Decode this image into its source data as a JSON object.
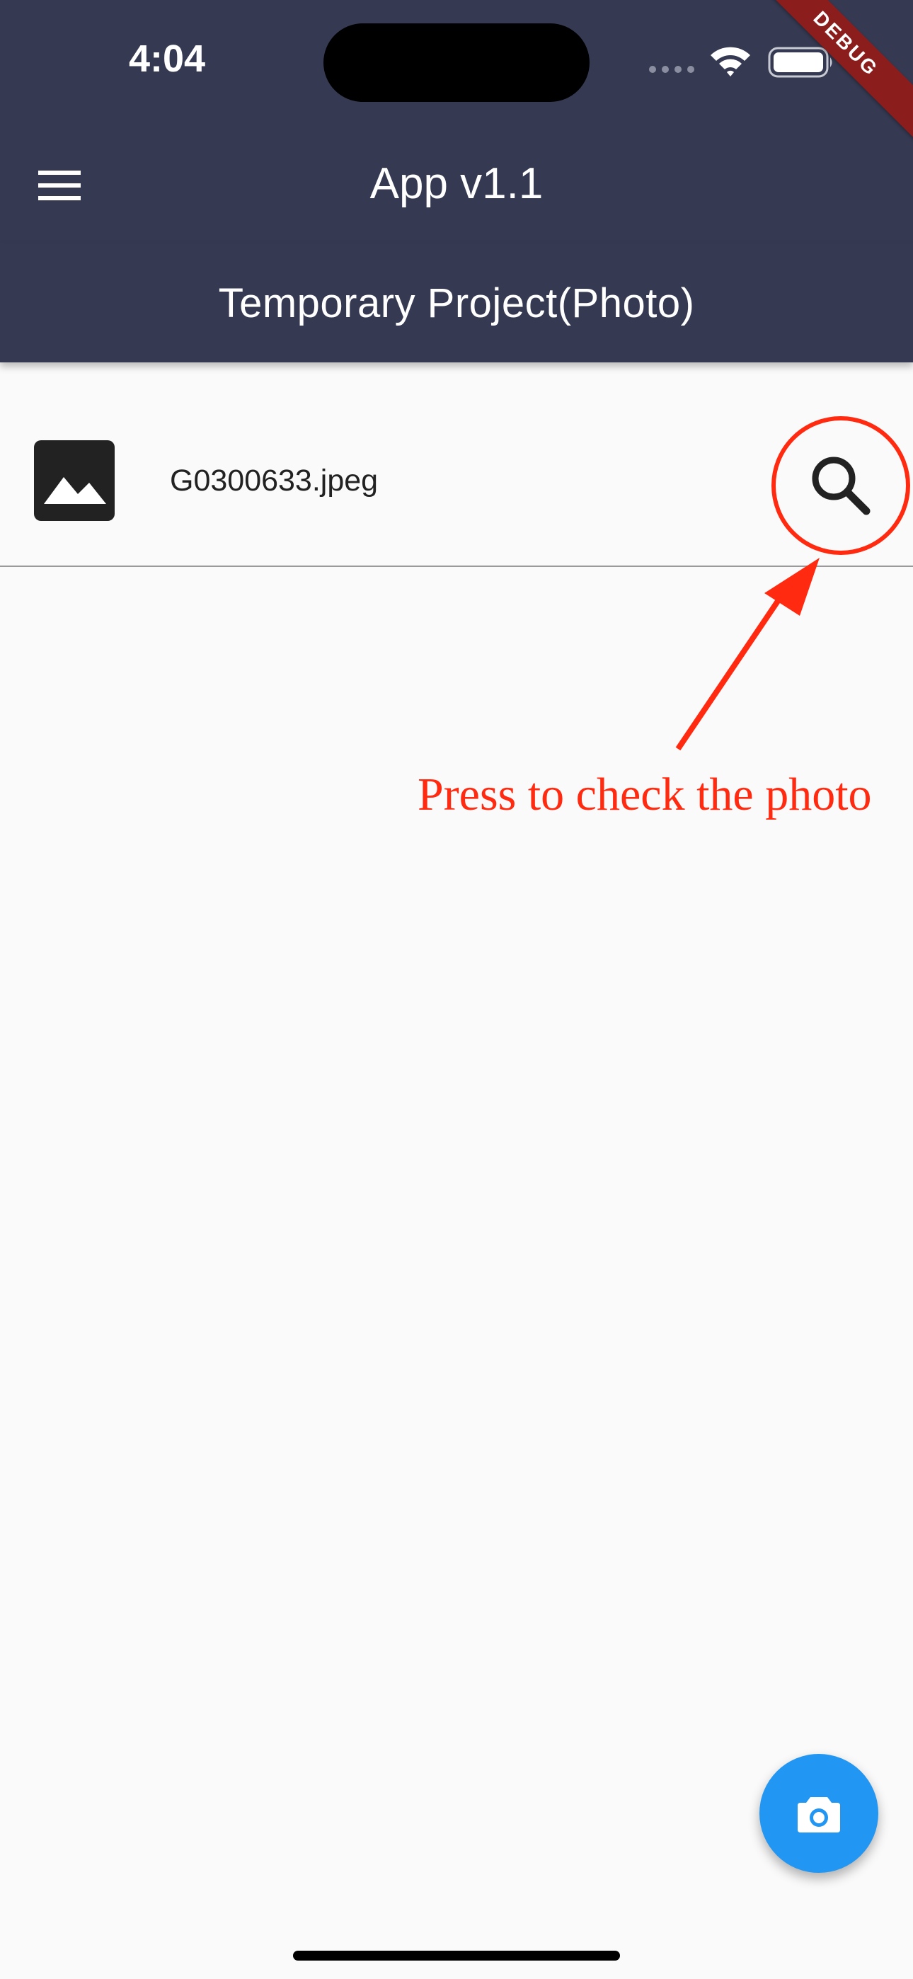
{
  "status_bar": {
    "time": "4:04"
  },
  "debug_banner": {
    "label": "DEBUG"
  },
  "app_bar": {
    "title": "App v1.1",
    "menu_icon": "menu-icon"
  },
  "sub_header": {
    "title": "Temporary Project(Photo)"
  },
  "photo_list": {
    "items": [
      {
        "icon": "image-icon",
        "file_name": "G0300633.jpeg",
        "action_icon": "search-icon"
      }
    ]
  },
  "annotation": {
    "text": "Press to check the photo",
    "color": "#ff2a10"
  },
  "fab": {
    "icon": "camera-icon",
    "color": "#2196f3"
  },
  "colors": {
    "app_bar": "#353a52",
    "background": "#fafafa",
    "debug_banner": "#8c1d1d"
  }
}
